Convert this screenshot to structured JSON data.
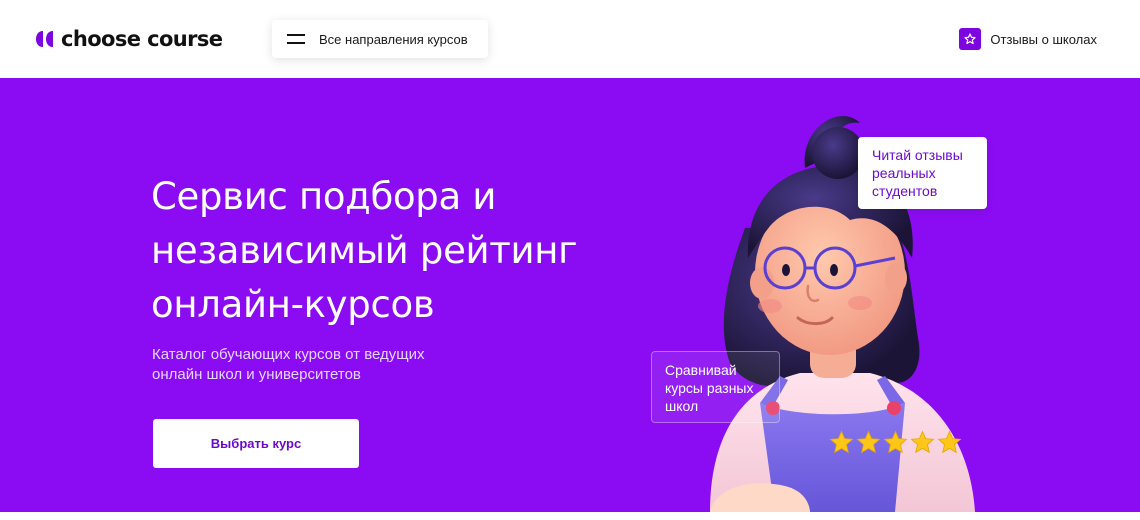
{
  "header": {
    "logo_text": "choose course",
    "directions_button": "Все направления курсов",
    "reviews_link": "Отзывы о школах"
  },
  "hero": {
    "title_lines": [
      "Сервис подбора и",
      "независимый рейтинг",
      "онлайн-курсов"
    ],
    "subtitle_lines": [
      "Каталог обучающих курсов от ведущих",
      "онлайн школ и университетов"
    ],
    "cta_label": "Выбрать курс",
    "bubble_top_lines": [
      "Читай отзывы",
      "реальных",
      "студентов"
    ],
    "bubble_left_lines": [
      "Сравнивай",
      "курсы разных",
      "школ"
    ],
    "rating_stars": 5
  },
  "colors": {
    "brand_purple": "#8b0cf2",
    "accent_purple": "#7d05df",
    "star_yellow": "#ffc61a"
  },
  "icons": [
    "logo-mark-icon",
    "burger-menu-icon",
    "star-icon",
    "rating-star-icon"
  ]
}
